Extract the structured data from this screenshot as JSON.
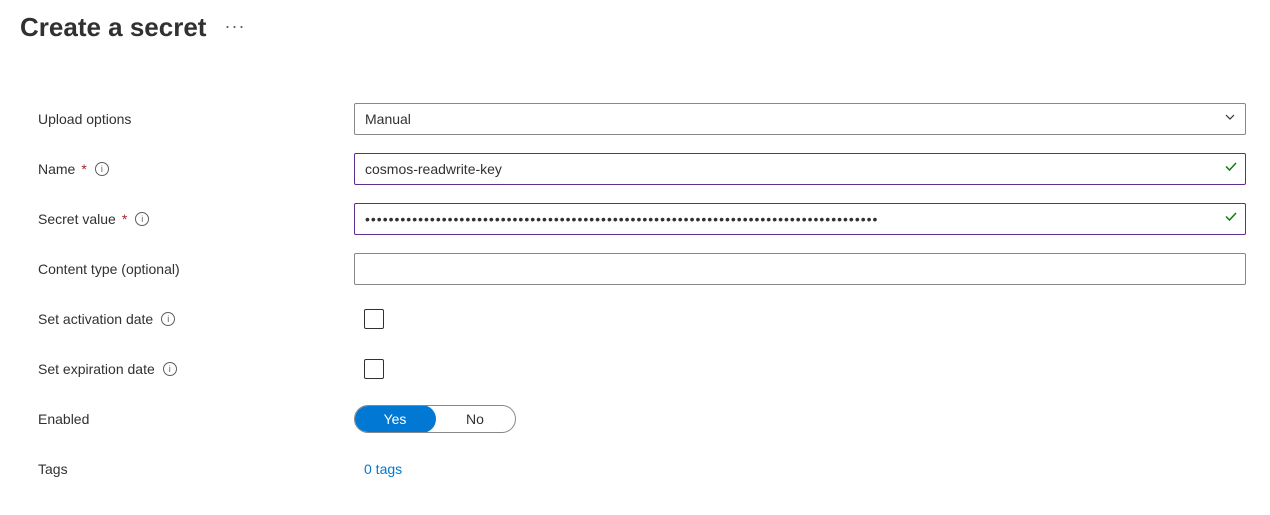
{
  "header": {
    "title": "Create a secret"
  },
  "form": {
    "upload_options": {
      "label": "Upload options",
      "value": "Manual"
    },
    "name": {
      "label": "Name",
      "value": "cosmos-readwrite-key"
    },
    "secret_value": {
      "label": "Secret value",
      "mask": "•••••••••••••••••••••••••••••••••••••••••••••••••••••••••••••••••••••••••••••••••••••••"
    },
    "content_type": {
      "label": "Content type (optional)",
      "value": ""
    },
    "activation": {
      "label": "Set activation date"
    },
    "expiration": {
      "label": "Set expiration date"
    },
    "enabled": {
      "label": "Enabled",
      "yes": "Yes",
      "no": "No"
    },
    "tags": {
      "label": "Tags",
      "value": "0 tags"
    }
  }
}
